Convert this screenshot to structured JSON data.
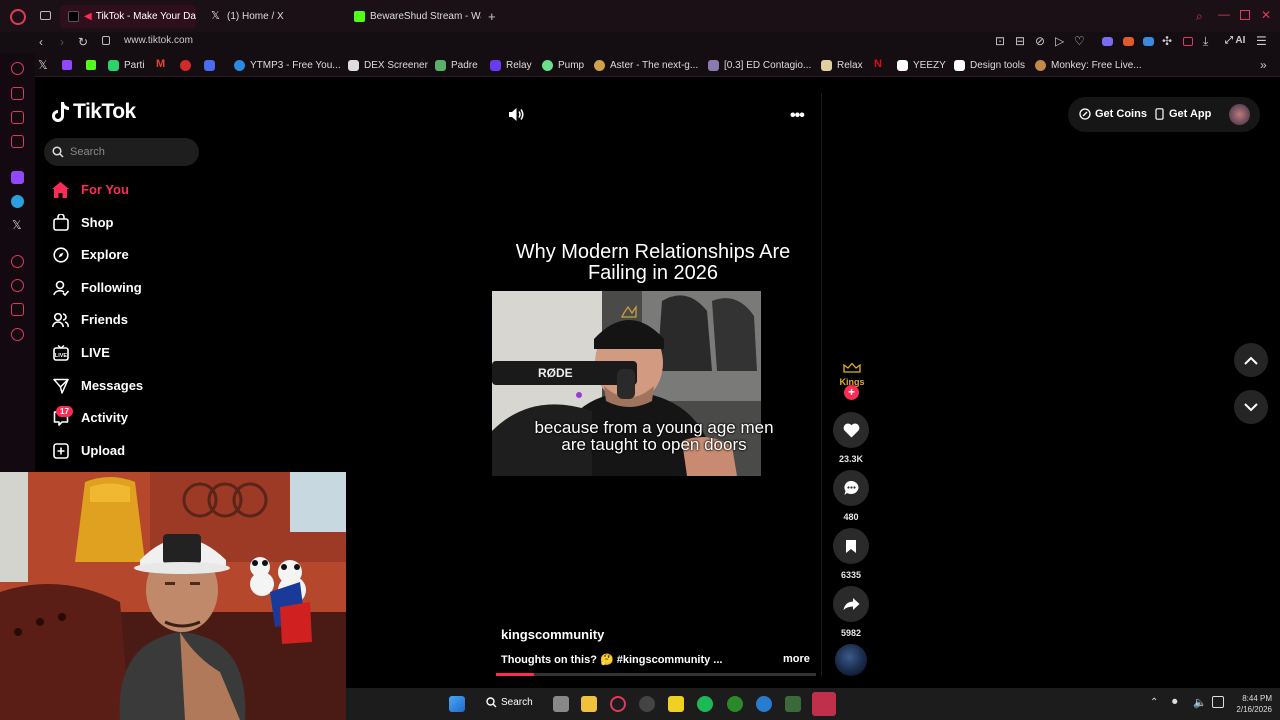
{
  "browser": {
    "tabs": [
      {
        "title": "TikTok - Make Your Da",
        "active": true
      },
      {
        "title": "(1) Home / X",
        "active": false
      },
      {
        "title": "BewareShud Stream - Wa",
        "active": false
      }
    ],
    "url": "www.tiktok.com",
    "ai_label": "AI",
    "bookmarks": [
      "Parti",
      "YTMP3 - Free You...",
      "DEX Screener",
      "Padre",
      "Relay",
      "Pump",
      "Aster - The next-g...",
      "[0.3] ED Contagio...",
      "Relax",
      "YEEZY",
      "Design tools",
      "Monkey: Free Live..."
    ]
  },
  "tiktok": {
    "logo_text": "TikTok",
    "search_placeholder": "Search",
    "nav": [
      {
        "label": "For You",
        "icon": "home-icon",
        "active": true
      },
      {
        "label": "Shop",
        "icon": "shop-icon"
      },
      {
        "label": "Explore",
        "icon": "compass-icon"
      },
      {
        "label": "Following",
        "icon": "following-icon"
      },
      {
        "label": "Friends",
        "icon": "friends-icon"
      },
      {
        "label": "LIVE",
        "icon": "live-icon"
      },
      {
        "label": "Messages",
        "icon": "messages-icon"
      },
      {
        "label": "Activity",
        "icon": "activity-icon"
      },
      {
        "label": "Upload",
        "icon": "upload-icon"
      }
    ],
    "activity_badge": "17",
    "get_coins": "Get Coins",
    "get_app": "Get App",
    "video": {
      "title": "Why Modern Relationships Are Failing in 2026",
      "frame_brand": "RØDE",
      "caption": "because from a young age men are taught to open doors",
      "author": "kingscommunity",
      "description": "Thoughts on this? 🤔 #kingscommunity ...",
      "more": "more",
      "progress": 0.12
    },
    "creator_avatar_text": "Kings",
    "actions": [
      {
        "name": "like",
        "icon": "heart-icon",
        "count": "23.3K"
      },
      {
        "name": "comment",
        "icon": "comment-icon",
        "count": "480"
      },
      {
        "name": "save",
        "icon": "bookmark-icon",
        "count": "6335"
      },
      {
        "name": "share",
        "icon": "share-icon",
        "count": "5982"
      }
    ]
  },
  "taskbar": {
    "search_label": "Search",
    "time": "8:44 PM",
    "date": "2/16/2026"
  },
  "colors": {
    "accent": "#fe2c55",
    "browser_accent": "#e03a5a"
  }
}
